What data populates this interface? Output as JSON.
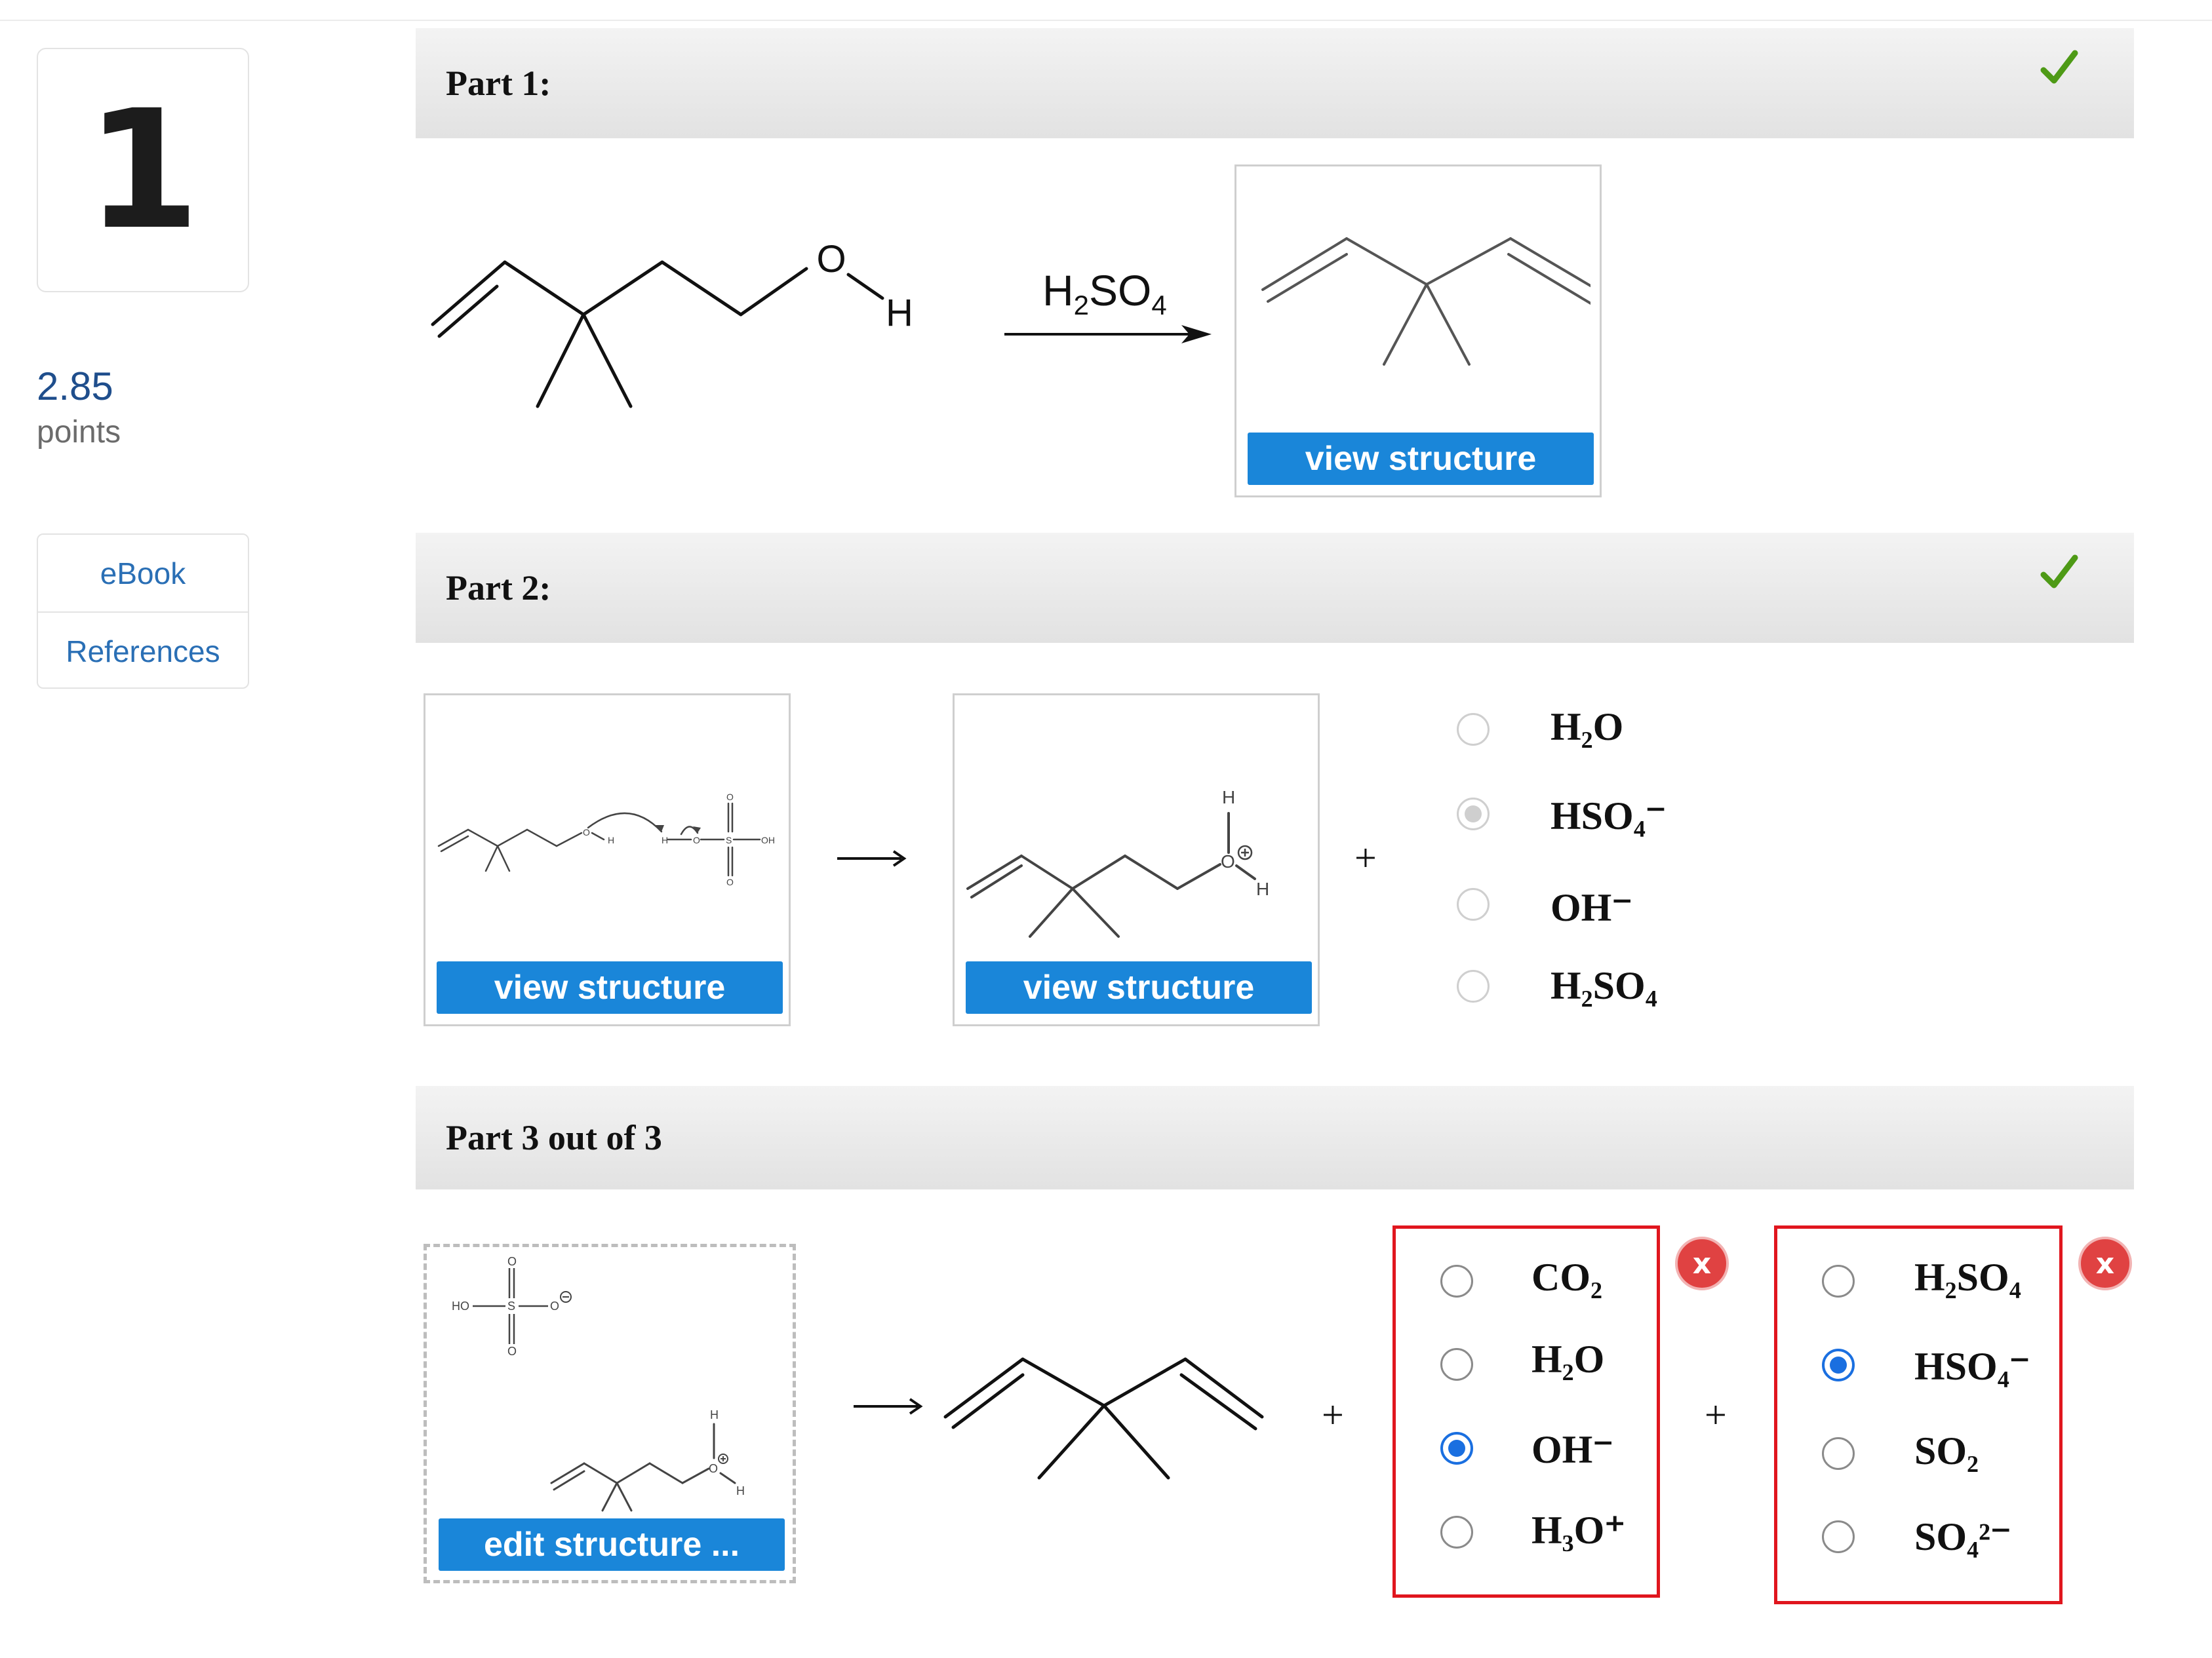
{
  "question": {
    "number": "1",
    "points_value": "2.85",
    "points_label": "points"
  },
  "side_links": [
    "eBook",
    "References"
  ],
  "part1": {
    "title": "Part 1:",
    "reagent": "H2SO4",
    "reactant_atoms": {
      "O": "O",
      "H": "H"
    },
    "view_button": "view structure"
  },
  "part2": {
    "title": "Part 2:",
    "view_button_left": "view structure",
    "view_button_right": "view structure",
    "plus": "+",
    "options": [
      {
        "formula": "H₂O",
        "state": "disabled"
      },
      {
        "formula": "HSO₄⁻",
        "state": "selected-gray"
      },
      {
        "formula": "OH⁻",
        "state": "disabled"
      },
      {
        "formula": "H₂SO₄",
        "state": "disabled"
      }
    ]
  },
  "part3": {
    "title": "Part 3 out of 3",
    "edit_button": "edit structure ...",
    "plus": "+",
    "group1_options": [
      {
        "formula": "CO₂",
        "selected": false
      },
      {
        "formula": "H₂O",
        "selected": false
      },
      {
        "formula": "OH⁻",
        "selected": true
      },
      {
        "formula": "H₃O⁺",
        "selected": false
      }
    ],
    "group2_options": [
      {
        "formula": "H₂SO₄",
        "selected": false
      },
      {
        "formula": "HSO₄⁻",
        "selected": true
      },
      {
        "formula": "SO₂",
        "selected": false
      },
      {
        "formula": "SO₄²⁻",
        "selected": false
      }
    ],
    "error_badge": "x"
  },
  "colors": {
    "accent_blue": "#1a86d9",
    "error_red": "#e0161e",
    "check_green": "#4e9a16",
    "points_blue": "#1f4e8c"
  },
  "icons": [
    "checkmark-icon",
    "error-x-icon",
    "reaction-arrow-icon"
  ]
}
